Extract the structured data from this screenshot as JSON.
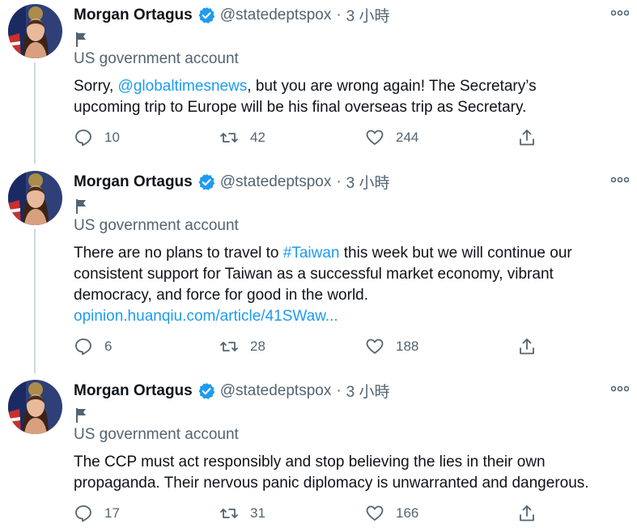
{
  "colors": {
    "accent": "#1d9bf0",
    "text": "#0f1419",
    "muted": "#536471"
  },
  "tweets": [
    {
      "name": "Morgan Ortagus",
      "handle": "@statedeptspox",
      "dot": "·",
      "time": "3 小時",
      "gov_label": "US government account",
      "text_parts": [
        "Sorry, ",
        "@globaltimesnews",
        ", but you are wrong again! The Secretary’s",
        "upcoming trip to Europe will be his final overseas trip as Secretary."
      ],
      "replies": "10",
      "retweets": "42",
      "likes": "244"
    },
    {
      "name": "Morgan Ortagus",
      "handle": "@statedeptspox",
      "dot": "·",
      "time": "3 小時",
      "gov_label": "US government account",
      "text_parts": [
        "There are no plans to travel to ",
        "#Taiwan",
        " this week but we will continue our",
        "consistent support for Taiwan as a successful market economy, vibrant",
        "democracy, and force for good in the world.",
        "opinion.huanqiu.com/article/41SWaw..."
      ],
      "replies": "6",
      "retweets": "28",
      "likes": "188"
    },
    {
      "name": "Morgan Ortagus",
      "handle": "@statedeptspox",
      "dot": "·",
      "time": "3 小時",
      "gov_label": "US government account",
      "text_parts": [
        "The CCP must act responsibly and stop believing the lies in their own",
        "propaganda. Their nervous panic diplomacy is unwarranted and dangerous."
      ],
      "replies": "17",
      "retweets": "31",
      "likes": "166"
    }
  ]
}
